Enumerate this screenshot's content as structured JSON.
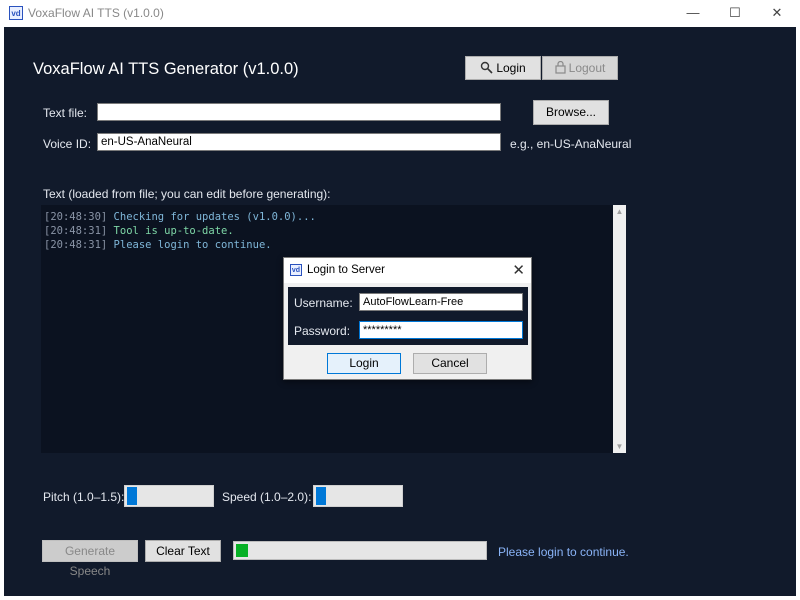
{
  "window": {
    "icon_text": "vd",
    "title": "VoxaFlow AI TTS (v1.0.0)",
    "minimize": "—",
    "maximize": "☐",
    "close": "✕"
  },
  "header": {
    "title": "VoxaFlow AI TTS Generator (v1.0.0)",
    "login_label": "Login",
    "logout_label": "Logout"
  },
  "form": {
    "text_file_label": "Text file:",
    "text_file_value": "",
    "browse_label": "Browse...",
    "voice_label": "Voice ID:",
    "voice_value": "en-US-AnaNeural",
    "voice_example": "e.g., en-US-AnaNeural",
    "text_area_label": "Text (loaded from file; you can edit before generating):"
  },
  "log": [
    {
      "time": "[20:48:30]",
      "message": "Checking for updates (v1.0.0)..."
    },
    {
      "time": "[20:48:31]",
      "message": "Tool is up-to-date."
    },
    {
      "time": "[20:48:31]",
      "message": "Please login to continue."
    }
  ],
  "controls": {
    "pitch_label": "Pitch (1.0–1.5):",
    "pitch_value": 1.0,
    "speed_label": "Speed (1.0–2.0):",
    "speed_value": 1.0,
    "generate_label": "Generate Speech",
    "clear_label": "Clear Text",
    "progress_fraction": 0.05,
    "status_text": "Please login to continue."
  },
  "dialog": {
    "icon_text": "vd",
    "title": "Login to Server",
    "close": "✕",
    "username_label": "Username:",
    "username_value": "AutoFlowLearn-Free",
    "password_label": "Password:",
    "password_value": "*********",
    "login_label": "Login",
    "cancel_label": "Cancel"
  },
  "colors": {
    "app_background": "#111a2b",
    "log_background": "#0b1220",
    "log_info": "#7fb6d8",
    "log_success": "#7ed6a6",
    "status_text": "#8ab4f8",
    "progress_fill": "#06b025",
    "slider_thumb": "#0078d7"
  },
  "icons": {
    "login": "magnifier-key-icon",
    "logout": "lock-icon"
  }
}
